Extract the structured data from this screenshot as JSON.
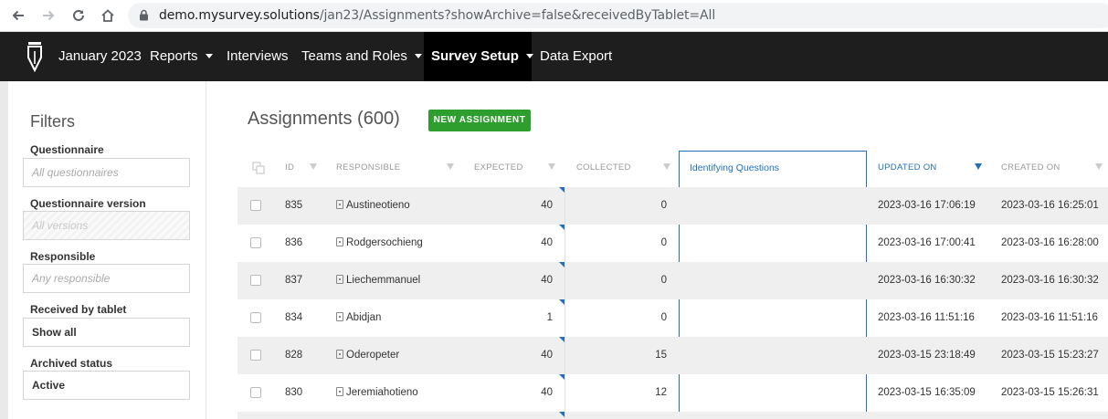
{
  "browser": {
    "url_host": "demo.mysurvey.solutions",
    "url_path": "/jan23/Assignments?showArchive=false&receivedByTablet=All"
  },
  "topnav": {
    "items": [
      {
        "label": "January 2023",
        "dropdown": false
      },
      {
        "label": "Reports",
        "dropdown": true
      },
      {
        "label": "Interviews",
        "dropdown": false
      },
      {
        "label": "Teams and Roles",
        "dropdown": true
      },
      {
        "label": "Survey Setup",
        "dropdown": true,
        "active": true
      },
      {
        "label": "Data Export",
        "dropdown": false
      }
    ]
  },
  "sidebar": {
    "title": "Filters",
    "filters": [
      {
        "label": "Questionnaire",
        "value": "All questionnaires",
        "state": "placeholder"
      },
      {
        "label": "Questionnaire version",
        "value": "All versions",
        "state": "disabled"
      },
      {
        "label": "Responsible",
        "value": "Any responsible",
        "state": "placeholder"
      },
      {
        "label": "Received by tablet",
        "value": "Show all",
        "state": "value"
      },
      {
        "label": "Archived status",
        "value": "Active",
        "state": "value"
      }
    ]
  },
  "main": {
    "title": "Assignments (600)",
    "new_button": "NEW ASSIGNMENT",
    "columns": [
      "ID",
      "RESPONSIBLE",
      "EXPECTED",
      "COLLECTED",
      "Identifying Questions",
      "UPDATED ON",
      "CREATED ON"
    ],
    "rows": [
      {
        "id": "835",
        "responsible": "Austineotieno",
        "expected": "40",
        "collected": "0",
        "updated": "2023-03-16 17:06:19",
        "created": "2023-03-16 16:25:01"
      },
      {
        "id": "836",
        "responsible": "Rodgersochieng",
        "expected": "40",
        "collected": "0",
        "updated": "2023-03-16 17:00:41",
        "created": "2023-03-16 16:28:00"
      },
      {
        "id": "837",
        "responsible": "Liechemmanuel",
        "expected": "40",
        "collected": "0",
        "updated": "2023-03-16 16:30:32",
        "created": "2023-03-16 16:30:32"
      },
      {
        "id": "834",
        "responsible": "Abidjan",
        "expected": "1",
        "collected": "0",
        "updated": "2023-03-16 11:51:16",
        "created": "2023-03-16 11:51:16"
      },
      {
        "id": "828",
        "responsible": "Oderopeter",
        "expected": "40",
        "collected": "15",
        "updated": "2023-03-15 23:18:49",
        "created": "2023-03-15 15:23:27"
      },
      {
        "id": "830",
        "responsible": "Jeremiahotieno",
        "expected": "40",
        "collected": "12",
        "updated": "2023-03-15 16:35:09",
        "created": "2023-03-15 15:26:31"
      }
    ]
  },
  "colors": {
    "accent": "#2370b8",
    "button_green": "#2e9e2e",
    "nav_bg": "#1e1e1e"
  }
}
